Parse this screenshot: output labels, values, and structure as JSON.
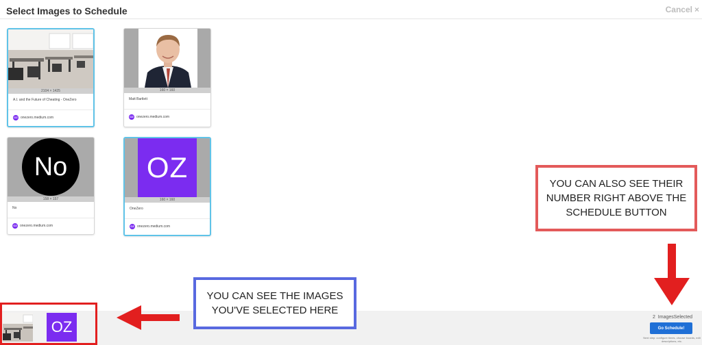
{
  "header": {
    "title": "Select Images to Schedule",
    "cancel_label": "Cancel",
    "close_glyph": "×"
  },
  "cards": [
    {
      "dims": "2104 × 1425",
      "caption": "A.I. and the Future of Cheating - OneZero",
      "domain": "onezero.medium.com",
      "selected": true,
      "thumb": "classroom-photo"
    },
    {
      "dims": "160 × 160",
      "caption": "Matt Bartlett",
      "domain": "onezero.medium.com",
      "selected": false,
      "thumb": "portrait-photo"
    },
    {
      "dims": "158 × 157",
      "caption": "No",
      "domain": "onezero.medium.com",
      "selected": false,
      "thumb": "no-logo",
      "logo_text": "No"
    },
    {
      "dims": "160 × 160",
      "caption": "OneZero",
      "domain": "onezero.medium.com",
      "selected": true,
      "thumb": "oz-logo",
      "logo_text": "OZ"
    }
  ],
  "favicon_text": "OZ",
  "selection_bar": {
    "count": "2",
    "count_label": "ImagesSelected",
    "button_label": "Go Schedule!",
    "next_step": "Next step: configure times, choose boards, edit descriptions, etc.",
    "selected_oz_text": "OZ"
  },
  "annotations": {
    "red_note": "YOU CAN ALSO SEE THEIR NUMBER RIGHT ABOVE THE SCHEDULE BUTTON",
    "blue_note": "YOU CAN SEE THE IMAGES YOU'VE SELECTED HERE"
  },
  "colors": {
    "selected_border": "#5fc3e8",
    "button": "#1f6fd6",
    "oz_purple": "#7b2cf0",
    "annotation_red": "#e21f1f",
    "annotation_blue": "#5869e0"
  }
}
